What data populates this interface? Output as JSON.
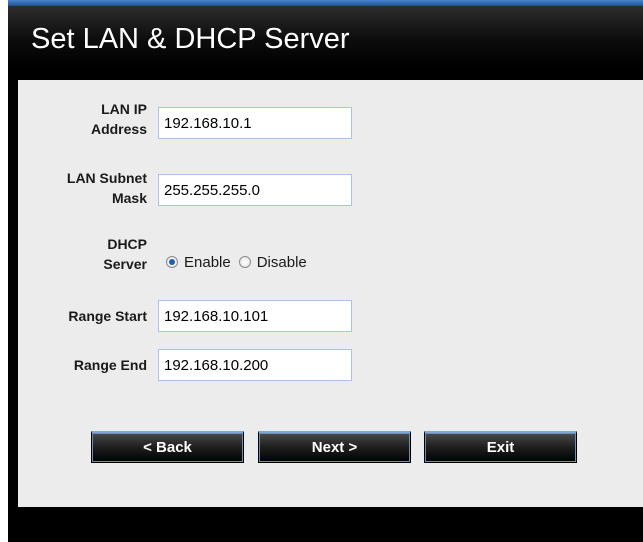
{
  "header": {
    "title": "Set LAN & DHCP Server"
  },
  "form": {
    "lan_ip": {
      "label_line1": "LAN IP",
      "label_line2": "Address",
      "value": "192.168.10.1"
    },
    "subnet": {
      "label_line1": "LAN Subnet",
      "label_line2": "Mask",
      "value": "255.255.255.0"
    },
    "dhcp": {
      "label_line1": "DHCP",
      "label_line2": "Server",
      "options": [
        {
          "label": "Enable",
          "checked": true
        },
        {
          "label": "Disable",
          "checked": false
        }
      ]
    },
    "range_start": {
      "label": "Range Start",
      "value": "192.168.10.101"
    },
    "range_end": {
      "label": "Range End",
      "value": "192.168.10.200"
    }
  },
  "buttons": {
    "back": "< Back",
    "next": "Next >",
    "exit": "Exit"
  },
  "colors": {
    "accent": "#1f5fae",
    "title_bg": "#000000",
    "panel_bg": "#ececec"
  }
}
